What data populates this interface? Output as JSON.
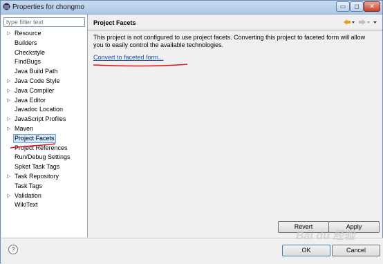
{
  "window": {
    "title": "Properties for chongmo",
    "minimize_glyph": "▭",
    "maximize_glyph": "◻",
    "close_glyph": "✕"
  },
  "sidebar": {
    "filter_placeholder": "type filter text",
    "items": [
      {
        "label": "Resource",
        "expandable": true
      },
      {
        "label": "Builders",
        "expandable": false
      },
      {
        "label": "Checkstyle",
        "expandable": false
      },
      {
        "label": "FindBugs",
        "expandable": false
      },
      {
        "label": "Java Build Path",
        "expandable": false
      },
      {
        "label": "Java Code Style",
        "expandable": true
      },
      {
        "label": "Java Compiler",
        "expandable": true
      },
      {
        "label": "Java Editor",
        "expandable": true
      },
      {
        "label": "Javadoc Location",
        "expandable": false
      },
      {
        "label": "JavaScript Profiles",
        "expandable": true
      },
      {
        "label": "Maven",
        "expandable": true
      },
      {
        "label": "Project Facets",
        "expandable": false,
        "selected": true
      },
      {
        "label": "Project References",
        "expandable": false
      },
      {
        "label": "Run/Debug Settings",
        "expandable": false
      },
      {
        "label": "Spket Task Tags",
        "expandable": false
      },
      {
        "label": "Task Repository",
        "expandable": true
      },
      {
        "label": "Task Tags",
        "expandable": false
      },
      {
        "label": "Validation",
        "expandable": true
      },
      {
        "label": "WikiText",
        "expandable": false
      }
    ]
  },
  "main": {
    "title": "Project Facets",
    "message": "This project is not configured to use project facets. Converting this project to faceted form will allow you to easily control the available technologies.",
    "link": "Convert to faceted form...",
    "revert_label": "Revert",
    "apply_label": "Apply"
  },
  "footer": {
    "help_glyph": "?",
    "ok_label": "OK",
    "cancel_label": "Cancel"
  },
  "colors": {
    "link": "#1a4cc3",
    "annotation": "#e0101a",
    "selection": "#cde8ff"
  },
  "watermark": "Bai du 经验"
}
